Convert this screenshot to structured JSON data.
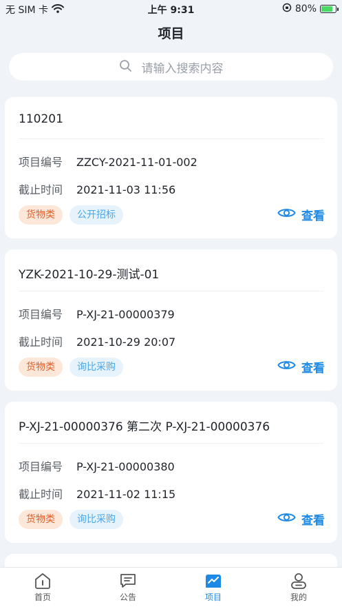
{
  "status_bar": {
    "carrier": "无 SIM 卡",
    "time": "上午 9:31",
    "battery": "80%",
    "battery_level": 0.8
  },
  "nav": {
    "title": "项目"
  },
  "search": {
    "placeholder": "请输入搜索内容"
  },
  "labels": {
    "project_no": "项目编号",
    "deadline": "截止时间",
    "view": "查看"
  },
  "projects": [
    {
      "title": "110201",
      "project_no": "ZZCY-2021-11-01-002",
      "deadline": "2021-11-03 11:56",
      "category": "货物类",
      "type": "公开招标"
    },
    {
      "title": "YZK-2021-10-29-测试-01",
      "project_no": "P-XJ-21-00000379",
      "deadline": "2021-10-29 20:07",
      "category": "货物类",
      "type": "询比采购"
    },
    {
      "title": "P-XJ-21-00000376 第二次 P-XJ-21-00000376",
      "project_no": "P-XJ-21-00000380",
      "deadline": "2021-11-02 11:15",
      "category": "货物类",
      "type": "询比采购"
    }
  ],
  "tabs": [
    {
      "label": "首页",
      "icon": "home-icon"
    },
    {
      "label": "公告",
      "icon": "message-icon"
    },
    {
      "label": "项目",
      "icon": "chart-icon",
      "active": true
    },
    {
      "label": "我的",
      "icon": "user-icon"
    }
  ],
  "colors": {
    "accent": "#1e8ae6",
    "category_tag": "#e0602a",
    "type_tag": "#4aa6e8",
    "background": "#f0f3f8"
  }
}
